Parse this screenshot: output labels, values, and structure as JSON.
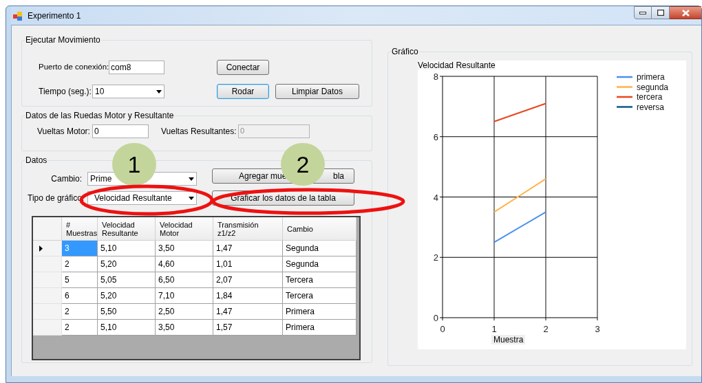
{
  "window": {
    "title": "Experimento 1"
  },
  "ejecutar": {
    "title": "Ejecutar Movimiento",
    "port_label": "Puerto de conexión:",
    "port_value": "com8",
    "time_label": "Tiempo (seg.):",
    "time_value": "10",
    "buttons": [
      {
        "label": "Conectar",
        "focused": false
      },
      {
        "label": "Rodar",
        "focused": true
      },
      {
        "label": "Limpiar Datos",
        "focused": false
      }
    ]
  },
  "ruedas": {
    "title": "Datos de las Ruedas Motor y Resultante",
    "motor_label": "Vueltas Motor:",
    "motor_value": "0",
    "result_label": "Vueltas Resultantes:",
    "result_value": "0",
    "result_disabled": true
  },
  "datos": {
    "title": "Datos",
    "cambio_label": "Cambio:",
    "cambio_value": "Prime",
    "tipo_label": "Tipo de gráfico:",
    "tipo_value": "Velocidad Resultante",
    "add_button": [
      "Agregar mue",
      "bla"
    ],
    "plot_button": "Graficar los datos de la tabla",
    "table": {
      "columns": [
        "# Muestras",
        "Velocidad Resultante",
        "Velocidad Motor",
        "Transmisión z1/z2",
        "Cambio"
      ],
      "rows": [
        {
          "selected": true,
          "cells": [
            "3",
            "5,10",
            "3,50",
            "1,47",
            "Segunda"
          ]
        },
        {
          "selected": false,
          "cells": [
            "2",
            "5,20",
            "4,60",
            "1,01",
            "Segunda"
          ]
        },
        {
          "selected": false,
          "cells": [
            "5",
            "5,05",
            "6,50",
            "2,07",
            "Tercera"
          ]
        },
        {
          "selected": false,
          "cells": [
            "6",
            "5,20",
            "7,10",
            "1,84",
            "Tercera"
          ]
        },
        {
          "selected": false,
          "cells": [
            "2",
            "5,50",
            "2,50",
            "1,47",
            "Primera"
          ]
        },
        {
          "selected": false,
          "cells": [
            "2",
            "5,10",
            "3,50",
            "1,57",
            "Primera"
          ]
        }
      ]
    }
  },
  "grafico": {
    "title": "Gráfico",
    "chart_data": {
      "type": "line",
      "grid": true,
      "legend": "right",
      "ylabel": "Velocidad Resultante",
      "xlabel": "Muestra",
      "x": [
        1,
        2
      ],
      "xlim": [
        0,
        3
      ],
      "ylim": [
        0,
        8
      ],
      "xticks": [
        0,
        1,
        2,
        3
      ],
      "yticks": [
        0,
        2,
        4,
        6,
        8
      ],
      "series": [
        {
          "name": "primera",
          "color": "#4a90f0",
          "values": [
            2.5,
            3.5
          ]
        },
        {
          "name": "segunda",
          "color": "#ffb347",
          "values": [
            3.5,
            4.6
          ]
        },
        {
          "name": "tercera",
          "color": "#e8461b",
          "values": [
            6.5,
            7.1
          ]
        },
        {
          "name": "reversa",
          "color": "#0b5a8c",
          "values": [
            null,
            null
          ]
        }
      ]
    }
  },
  "annotations": [
    {
      "label": "1"
    },
    {
      "label": "2"
    }
  ]
}
